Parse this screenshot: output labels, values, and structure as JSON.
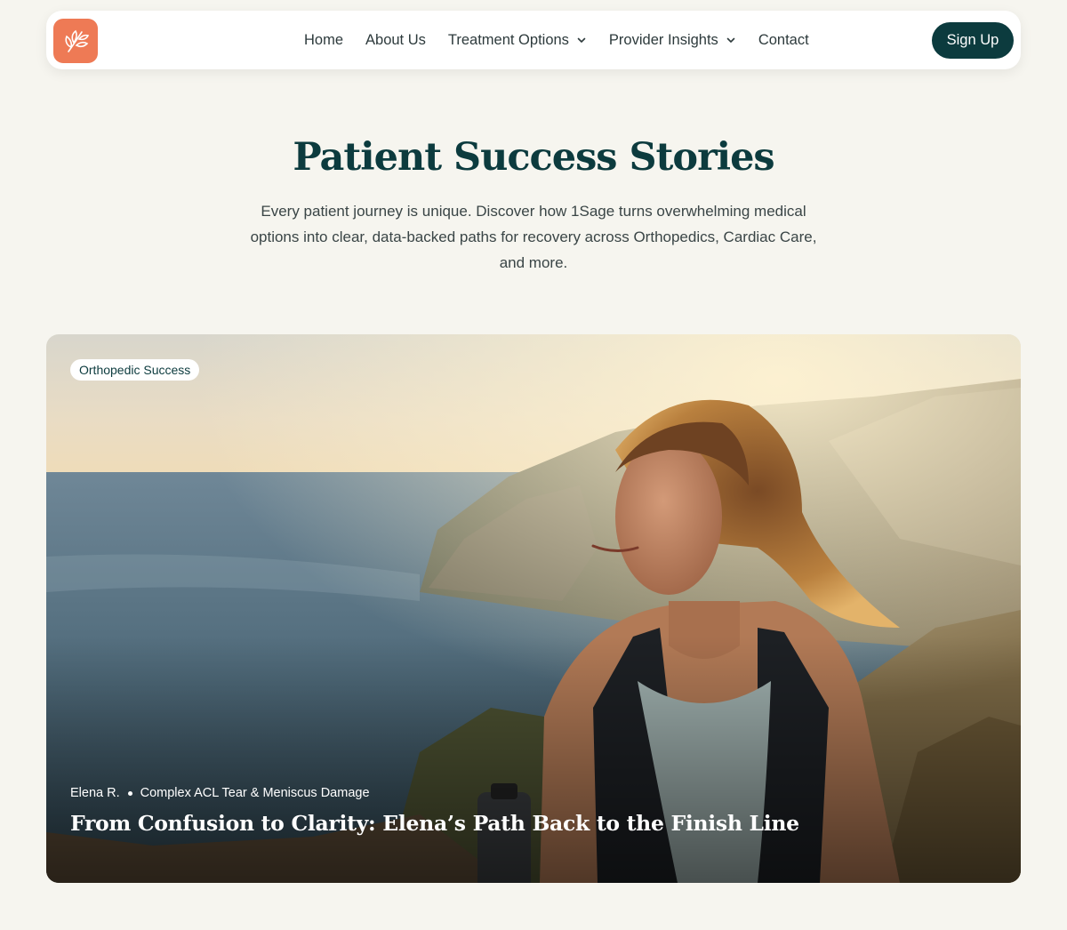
{
  "nav": {
    "logo_icon": "leaf-icon",
    "links": [
      {
        "label": "Home",
        "has_dropdown": false
      },
      {
        "label": "About Us",
        "has_dropdown": false
      },
      {
        "label": "Treatment Options",
        "has_dropdown": true
      },
      {
        "label": "Provider Insights",
        "has_dropdown": true
      },
      {
        "label": "Contact",
        "has_dropdown": false
      }
    ],
    "signup_label": "Sign Up"
  },
  "hero": {
    "title": "Patient Success Stories",
    "intro": "Every patient journey is unique. Discover how 1Sage turns overwhelming medical options into clear, data-backed paths for recovery across Orthopedics, Cardiac Care, and more."
  },
  "story": {
    "tag": "Orthopedic Success",
    "patient": "Elena R.",
    "condition": "Complex ACL Tear & Meniscus Damage",
    "title": "From Confusion to Clarity: Elena’s Path Back to the Finish Line"
  },
  "colors": {
    "background": "#f6f5ef",
    "brand_dark": "#0c3b3e",
    "logo_orange": "#ee7a55"
  }
}
